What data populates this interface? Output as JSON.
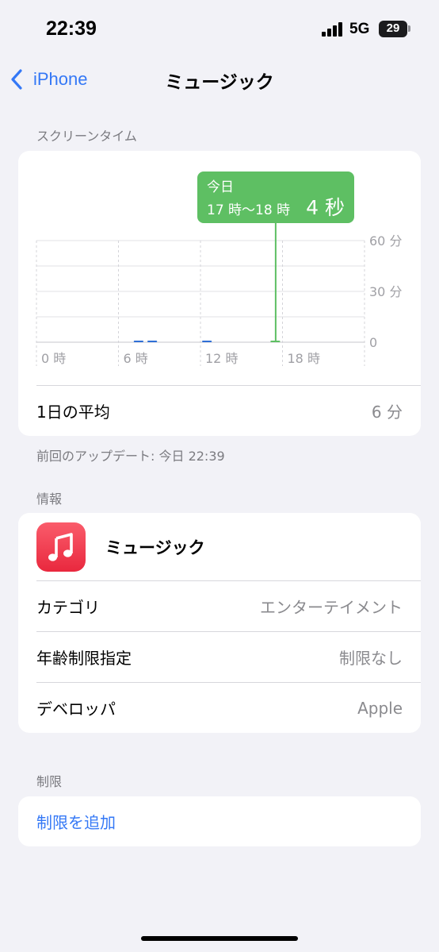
{
  "status_bar": {
    "time": "22:39",
    "network": "5G",
    "battery": "29"
  },
  "nav": {
    "back_label": "iPhone",
    "title": "ミュージック"
  },
  "screen_time": {
    "section_label": "スクリーンタイム",
    "tooltip": {
      "line1": "今日",
      "range": "17 時〜18 時",
      "value": "4 秒"
    },
    "avg_label": "1日の平均",
    "avg_value": "6 分",
    "last_update": "前回のアップデート: 今日 22:39"
  },
  "chart_data": {
    "type": "bar",
    "x_ticks": [
      "0 時",
      "6 時",
      "12 時",
      "18 時"
    ],
    "y_ticks": [
      "60 分",
      "30 分",
      "0"
    ],
    "ylim": [
      0,
      60
    ],
    "hours": [
      0,
      1,
      2,
      3,
      4,
      5,
      6,
      7,
      8,
      9,
      10,
      11,
      12,
      13,
      14,
      15,
      16,
      17,
      18,
      19,
      20,
      21,
      22,
      23
    ],
    "values": [
      0,
      0,
      0,
      0,
      0,
      0,
      0,
      0.2,
      0.2,
      0,
      0,
      0,
      0.6,
      0,
      0,
      0,
      0,
      0.07,
      0,
      0,
      0,
      0,
      0,
      0
    ],
    "highlight_hour": 17,
    "bar_color": "#2f6fd6",
    "highlight_color": "#5ebf63"
  },
  "info": {
    "section_label": "情報",
    "app_name": "ミュージック",
    "rows": [
      {
        "label": "カテゴリ",
        "value": "エンターテイメント"
      },
      {
        "label": "年齢制限指定",
        "value": "制限なし"
      },
      {
        "label": "デベロッパ",
        "value": "Apple"
      }
    ]
  },
  "limits": {
    "section_label": "制限",
    "add_label": "制限を追加"
  },
  "colors": {
    "accent": "#3478f6",
    "background": "#f2f2f7",
    "tooltip": "#5ebf63",
    "app_icon": "#f0394e"
  }
}
